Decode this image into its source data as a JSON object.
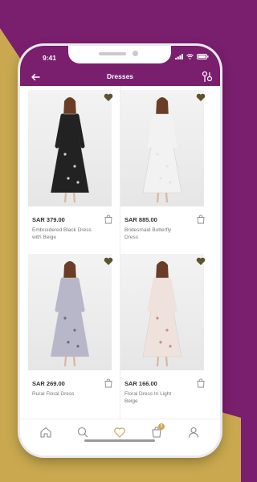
{
  "status_bar": {
    "time": "9:41"
  },
  "header": {
    "title": "Dresses"
  },
  "products": [
    {
      "price": "SAR 379.00",
      "name": "Embroidered Black Dress with Beige",
      "dress_color": "#222222",
      "pattern": "#d9d3c7"
    },
    {
      "price": "SAR 885.00",
      "name": "Bridesmaid Butterfly Dress",
      "dress_color": "#f2f2f2",
      "pattern": "#e5e5e5"
    },
    {
      "price": "SAR 269.00",
      "name": "Rural Floral Dress",
      "dress_color": "#b8b6c9",
      "pattern": "#6b6a85"
    },
    {
      "price": "SAR 166.00",
      "name": "Floral Dress In Light Beige",
      "dress_color": "#efe2dc",
      "pattern": "#c98c88"
    }
  ],
  "tabbar": {
    "cart_count": "0"
  },
  "colors": {
    "brand": "#7a1e6e",
    "accent": "#c9a84f",
    "heart": "#5c5430"
  }
}
